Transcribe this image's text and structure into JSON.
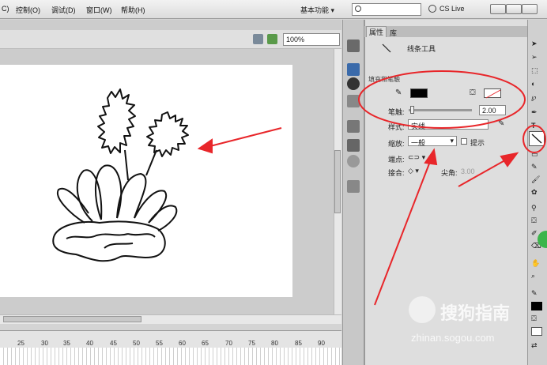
{
  "menu": {
    "items": [
      "C)",
      "控制(O)",
      "调试(D)",
      "窗口(W)",
      "帮助(H)"
    ],
    "workspace": "基本功能",
    "cs_live": "CS Live"
  },
  "stage": {
    "zoom": "100%"
  },
  "timeline": {
    "ticks": [
      "25",
      "30",
      "35",
      "40",
      "45",
      "50",
      "55",
      "60",
      "65",
      "70",
      "75",
      "80",
      "85",
      "90"
    ]
  },
  "panel": {
    "tab_properties": "属性",
    "tab_library": "库",
    "tool_name": "线条工具",
    "section_fill_stroke": "填充和笔触",
    "stroke_label": "笔触:",
    "stroke_value": "2.00",
    "style_label": "样式:",
    "style_value": "实线",
    "scale_label": "缩放:",
    "scale_value": "一般",
    "hint_label": "提示",
    "cap_label": "端点:",
    "join_label": "接合:",
    "miter_label": "尖角:",
    "miter_value": "3.00"
  },
  "watermark": {
    "text": "搜狗指南",
    "url": "zhinan.sogou.com"
  },
  "colors": {
    "annotation": "#e8262a",
    "stroke_color": "#000000"
  }
}
